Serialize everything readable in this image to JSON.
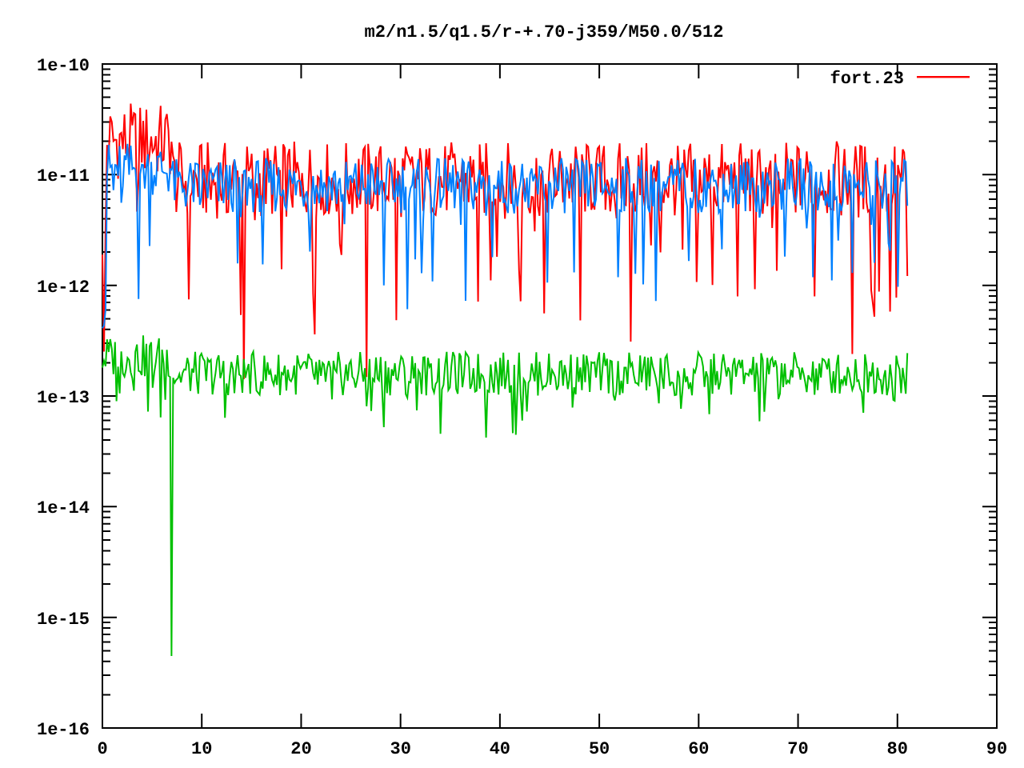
{
  "chart": {
    "title": "m2/n1.5/q1.5/r-+.70-j359/M50.0/512",
    "legend": [
      {
        "label": "fort.23",
        "color": "#ff0000"
      }
    ],
    "series": [
      {
        "color": "#ff0000"
      },
      {
        "color": "#0080ff"
      },
      {
        "color": "#00c000"
      }
    ],
    "yticks": [
      "1e-10",
      "1e-11",
      "1e-12",
      "1e-13",
      "1e-14",
      "1e-15",
      "1e-16"
    ],
    "xticks": [
      "0",
      "10",
      "20",
      "30",
      "40",
      "50",
      "60",
      "70",
      "80",
      "90"
    ]
  }
}
